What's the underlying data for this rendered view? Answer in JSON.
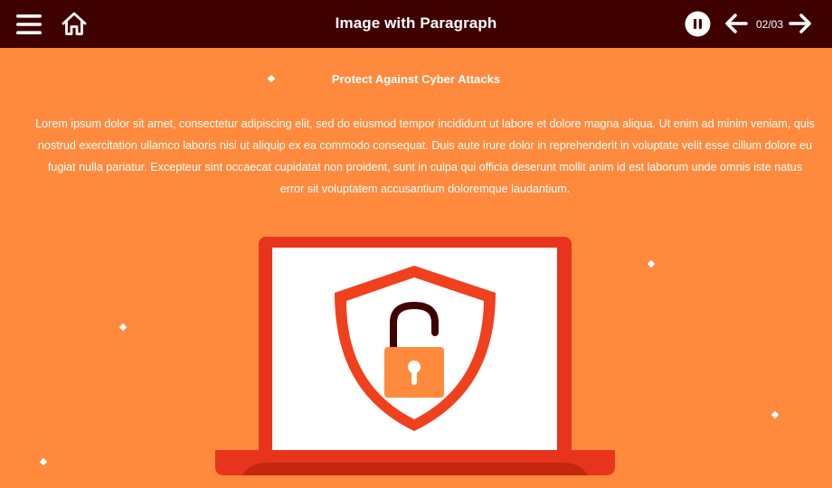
{
  "header": {
    "title": "Image with Paragraph",
    "page_counter": "02/03",
    "icons": {
      "menu": "hamburger-menu-icon",
      "home": "home-icon",
      "pause": "pause-icon",
      "prev": "arrow-left-icon",
      "next": "arrow-right-icon"
    }
  },
  "content": {
    "heading": "Protect Against Cyber Attacks",
    "paragraph": "Lorem ipsum dolor sit amet, consectetur adipiscing elit, sed do eiusmod tempor incididunt ut labore et dolore magna aliqua. Ut enim ad minim veniam, quis nostrud exercitation ullamco laboris nisi ut aliquip ex ea commodo consequat. Duis aute irure dolor in reprehenderit in voluptate velit esse cillum dolore eu fugiat nulla pariatur. Excepteur sint occaecat cupidatat non proident, sunt in culpa qui officia deserunt mollit anim id est laborum unde omnis iste natus error sit voluptatem accusantium doloremque laudantium.",
    "illustration": "laptop-shield-unlocked-padlock"
  },
  "colors": {
    "header_bg": "#3f0000",
    "page_bg": "#ff8a3d",
    "laptop_red": "#e8341c",
    "shield_red": "#f0401d",
    "padlock_orange": "#ff8a3d",
    "shackle_dark": "#3f0000",
    "text": "#ffffff"
  }
}
